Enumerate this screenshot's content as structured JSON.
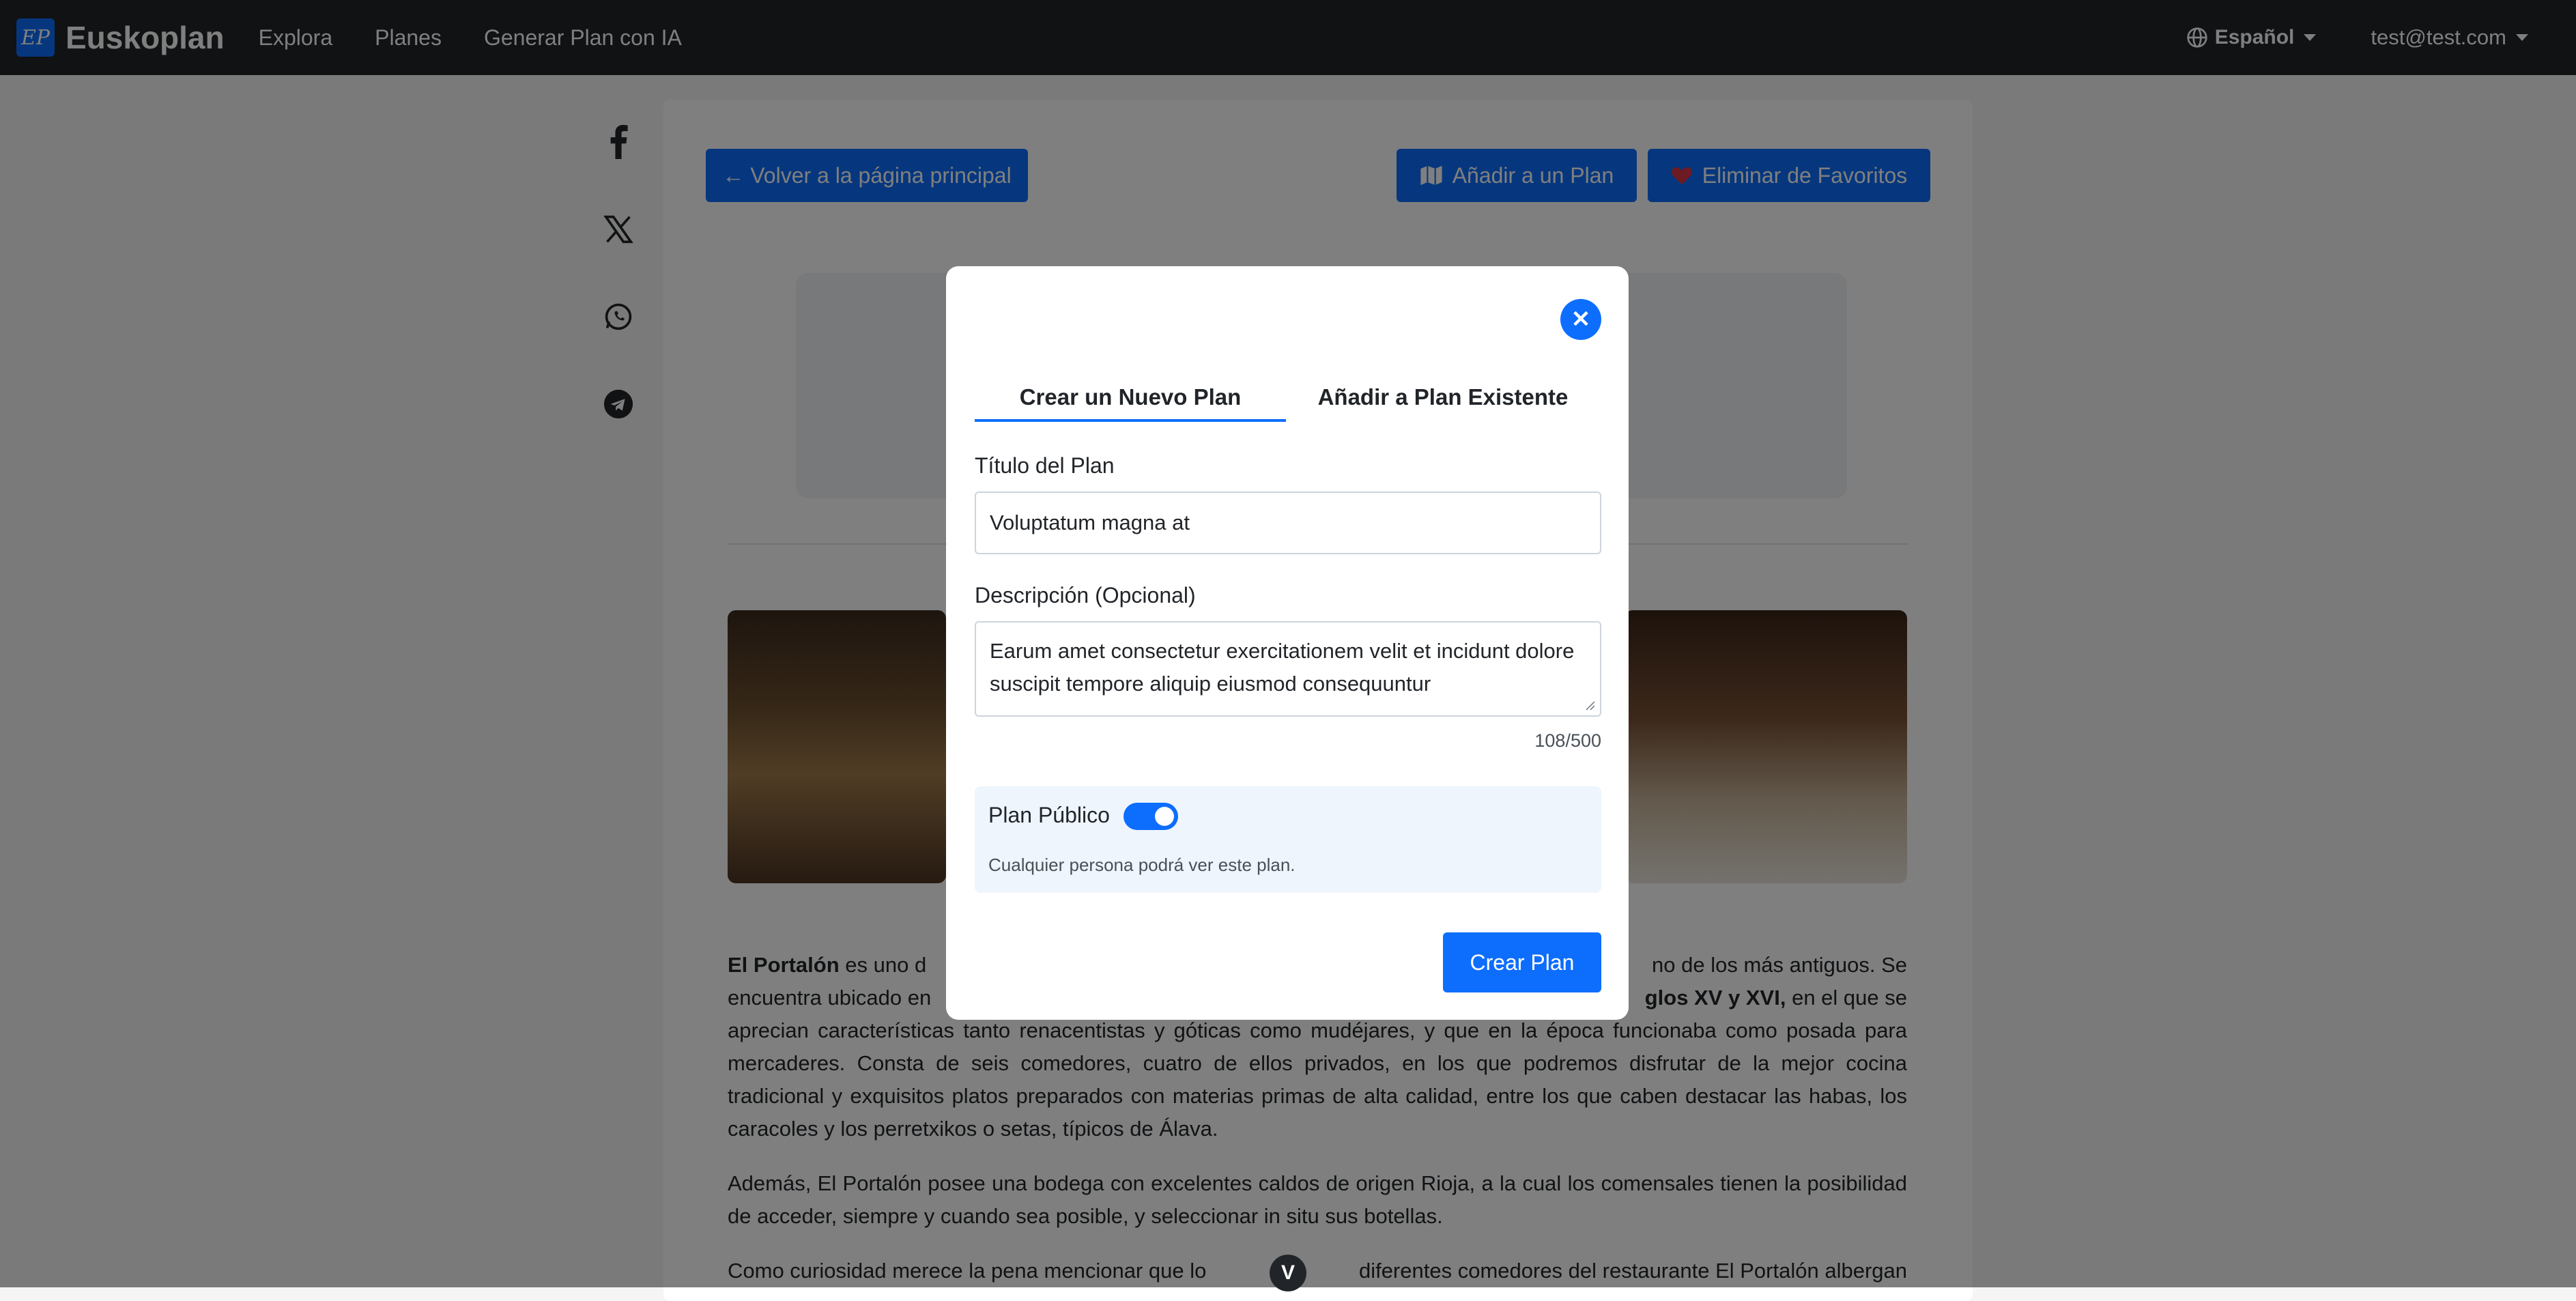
{
  "navbar": {
    "brand_logo": "EP",
    "brand_name": "Euskoplan",
    "links": [
      "Explora",
      "Planes",
      "Generar Plan con IA"
    ],
    "language": "Español",
    "user": "test@test.com"
  },
  "share": {
    "icons": [
      "facebook-icon",
      "x-icon",
      "whatsapp-icon",
      "telegram-icon"
    ]
  },
  "page": {
    "back_button": "← Volver a la página principal",
    "add_to_plan_button": "Añadir a un Plan",
    "remove_favorite_button": "Eliminar de Favoritos",
    "para1_bold_start": "El Portalón",
    "para1_visible_a": " es uno d",
    "para1_visible_b": "no de los más antiguos. Se",
    "para1_line2_a": "encuentra ubicado en",
    "para1_line2_bold": "glos XV y XVI,",
    "para1_line2_b": " en el que se",
    "para1_rest": "aprecian características tanto renacentistas y góticas como mudéjares, y que en la época funcionaba como posada para mercaderes. Consta de seis comedores, cuatro de ellos privados, en los que podremos disfrutar de la mejor cocina tradicional y exquisitos platos preparados con materias primas de alta calidad, entre los que caben destacar las habas, los caracoles y los perretxikos o setas, típicos de Álava.",
    "para2": "Además, El Portalón posee una bodega con excelentes caldos de origen Rioja, a la cual los comensales tienen la posibilidad de acceder, siempre y cuando sea posible, y seleccionar in situ sus botellas.",
    "para3_a": "Como curiosidad merece la pena mencionar que lo",
    "para3_b": "diferentes comedores del restaurante El Portalón albergan"
  },
  "modal": {
    "close_symbol": "✕",
    "tabs": [
      "Crear un Nuevo Plan",
      "Añadir a Plan Existente"
    ],
    "title_label": "Título del Plan",
    "title_value": "Voluptatum magna at",
    "description_label": "Descripción (Opcional)",
    "description_value": "Earum amet consectetur exercitationem velit et incidunt dolore suscipit tempore aliquip eiusmod consequuntur",
    "char_counter": "108/500",
    "public_label": "Plan Público",
    "public_enabled": true,
    "public_hint": "Cualquier persona podrá ver este plan.",
    "create_button": "Crear Plan"
  },
  "scroll_down_symbol": "V",
  "colors": {
    "navbar": "#212529",
    "primary": "#0d6efd",
    "favorite_heart": "#dc3545",
    "public_box": "#eef5fd"
  }
}
